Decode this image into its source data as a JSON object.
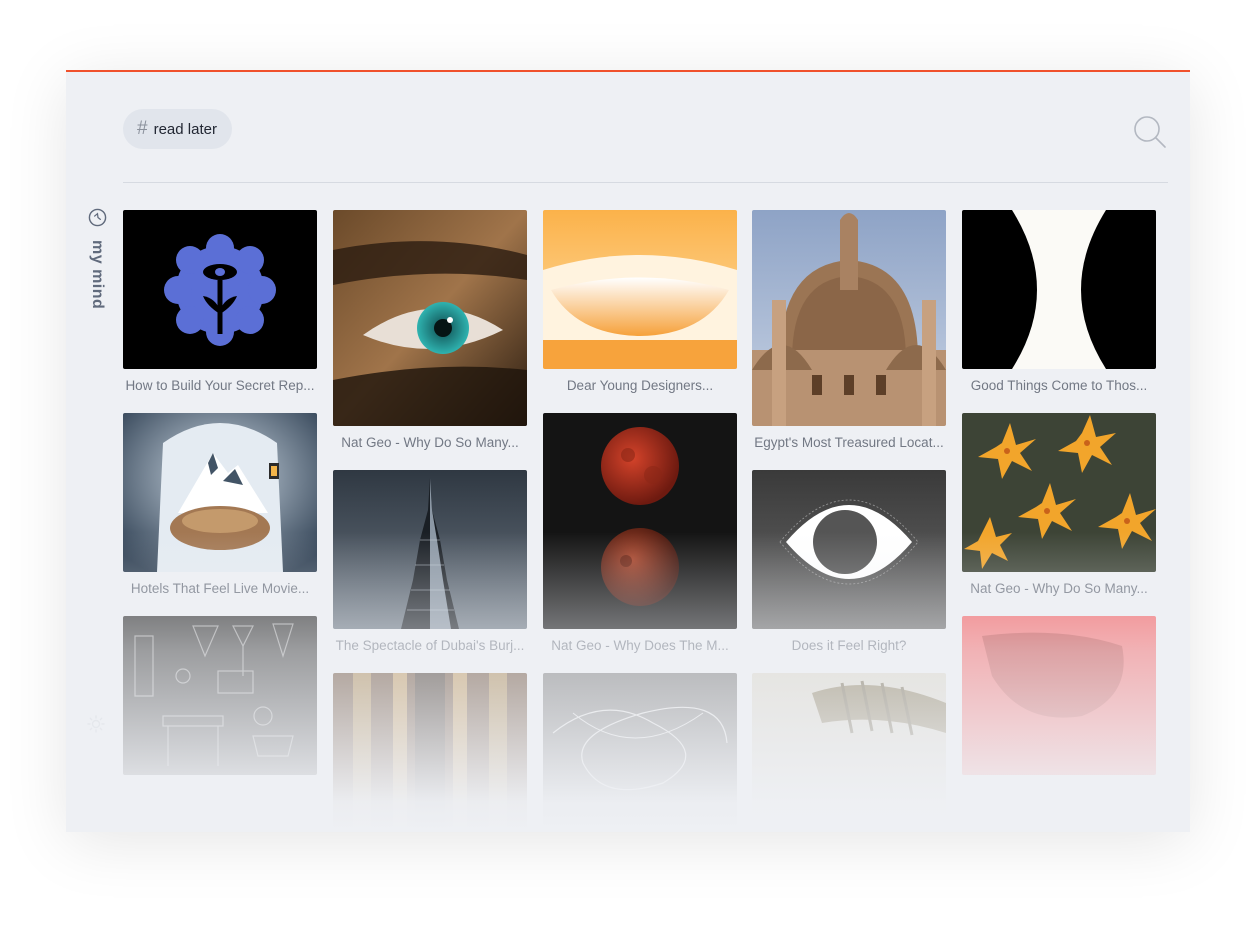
{
  "colors": {
    "accent": "#f0512c",
    "window_bg": "#eef0f4",
    "chip_bg": "#e1e5ec"
  },
  "header": {
    "tag": {
      "icon": "hash-icon",
      "label": "read later"
    },
    "search": {
      "icon": "search-icon"
    }
  },
  "sidebar": {
    "brand_icon": "mymind-logo-icon",
    "brand_label": "my mind",
    "theme_icon": "sun-icon"
  },
  "cards": [
    {
      "title": "How to Build Your Secret Rep...",
      "image": "blue-brain-flower"
    },
    {
      "title": "Hotels That Feel Live Movie...",
      "image": "ice-cave-mountain"
    },
    {
      "title": "",
      "image": "sketch-tools"
    },
    {
      "title": "Nat Geo - Why Do So Many...",
      "image": "eye-closeup"
    },
    {
      "title": "The Spectacle of Dubai's Burj...",
      "image": "burj-khalifa"
    },
    {
      "title": "",
      "image": "corridor"
    },
    {
      "title": "Dear Young Designers...",
      "image": "orange-gradient"
    },
    {
      "title": "Nat Geo - Why Does The M...",
      "image": "blood-moon"
    },
    {
      "title": "",
      "image": "line-scribble"
    },
    {
      "title": "Egypt's Most Treasured Locat...",
      "image": "mosque-dome"
    },
    {
      "title": "Does it Feel Right?",
      "image": "eye-graphic"
    },
    {
      "title": "",
      "image": "palm-leaves"
    },
    {
      "title": "Good Things Come to Thos...",
      "image": "hourglass-shape"
    },
    {
      "title": "Nat Geo - Why Do So Many...",
      "image": "orange-lilies"
    },
    {
      "title": "",
      "image": "red-abstract"
    }
  ]
}
